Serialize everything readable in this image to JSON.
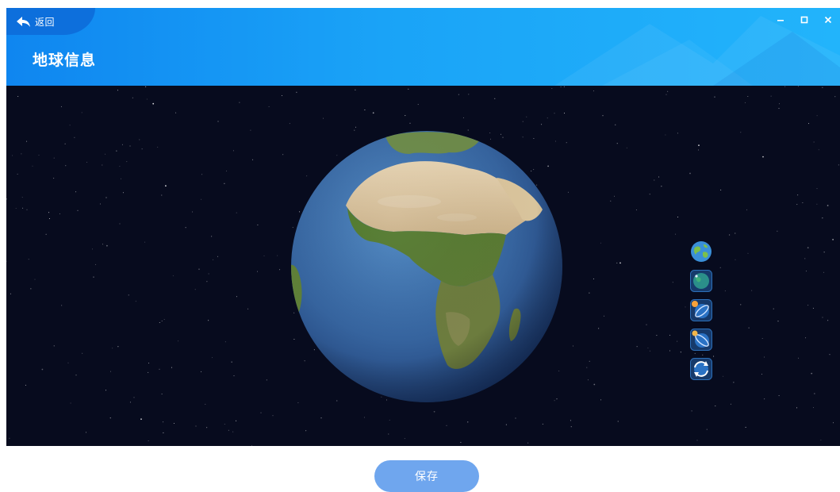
{
  "header": {
    "back_label": "返回",
    "title": "地球信息",
    "controls": [
      "minimize-icon",
      "maximize-icon",
      "close-icon"
    ]
  },
  "viewer": {
    "tools": [
      {
        "name": "earth-view-icon"
      },
      {
        "name": "globe-layer-icon"
      },
      {
        "name": "orbit-sun-icon"
      },
      {
        "name": "orbit-moon-icon"
      },
      {
        "name": "rotate-icon"
      }
    ]
  },
  "footer": {
    "save_label": "保存"
  },
  "colors": {
    "header_start": "#0f86f0",
    "header_end": "#22b4fb",
    "back_bg": "#0d6fdc",
    "space": "#070b1e",
    "save_button": "#6fa6ee"
  }
}
